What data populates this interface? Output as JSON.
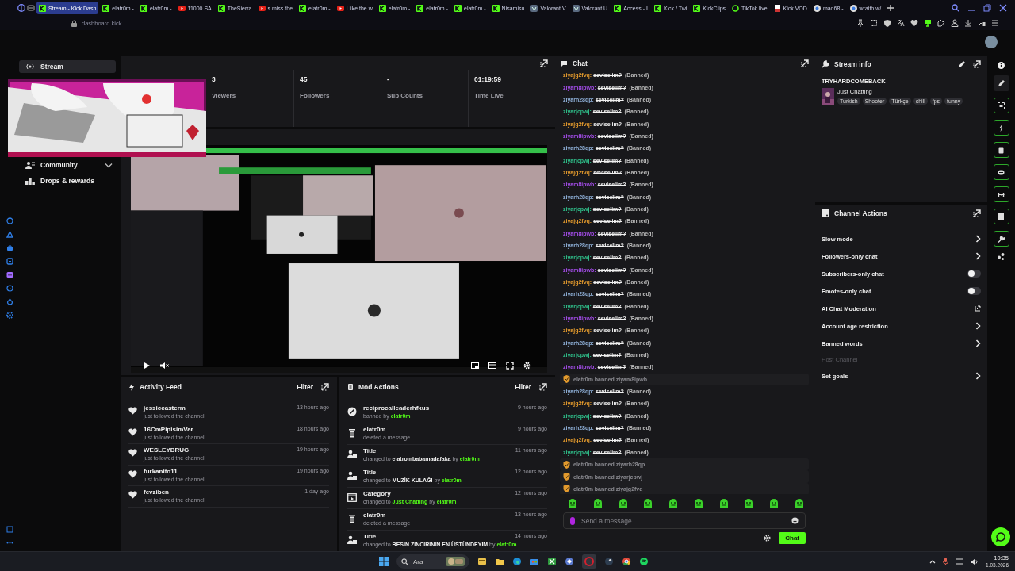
{
  "browser": {
    "tabs": [
      {
        "title": "Stream - Kick Dash",
        "kind": "kick",
        "selected": true
      },
      {
        "title": "elatr0m -",
        "kind": "kick",
        "selected": false
      },
      {
        "title": "elatr0m -",
        "kind": "kick",
        "selected": false
      },
      {
        "title": "11000 SA",
        "kind": "video",
        "selected": false
      },
      {
        "title": "TheSierra",
        "kind": "kick",
        "selected": false
      },
      {
        "title": "s miss the",
        "kind": "video",
        "selected": false
      },
      {
        "title": "elatr0m -",
        "kind": "kick",
        "selected": false
      },
      {
        "title": "I like the w",
        "kind": "video",
        "selected": false
      },
      {
        "title": "elatr0m -",
        "kind": "kick",
        "selected": false
      },
      {
        "title": "elatr0m -",
        "kind": "kick",
        "selected": false
      },
      {
        "title": "elatr0m -",
        "kind": "kick",
        "selected": false
      },
      {
        "title": "Nisamisu",
        "kind": "kick",
        "selected": false
      },
      {
        "title": "Valorant V",
        "kind": "game",
        "selected": false
      },
      {
        "title": "Valorant U",
        "kind": "game",
        "selected": false
      },
      {
        "title": "Access - I",
        "kind": "kick",
        "selected": false
      },
      {
        "title": "Kick / Twi",
        "kind": "kick",
        "selected": false
      },
      {
        "title": "KickClips",
        "kind": "kick",
        "selected": false
      },
      {
        "title": "TikTok live",
        "kind": "ring",
        "selected": false
      },
      {
        "title": "Kick VOD",
        "kind": "doc",
        "selected": false
      },
      {
        "title": "mad68 -",
        "kind": "globe",
        "selected": false
      },
      {
        "title": "wraith w/",
        "kind": "globe",
        "selected": false
      }
    ],
    "address": "dashboard.kick"
  },
  "sidebar": {
    "items": [
      {
        "label": "Stream",
        "kind": "stream",
        "selected": true,
        "expandable": false
      },
      {
        "label": "Community",
        "kind": "community",
        "selected": false,
        "expandable": true
      },
      {
        "label": "Drops & rewards",
        "kind": "drops",
        "selected": false,
        "expandable": false
      }
    ]
  },
  "stats": [
    {
      "value": "3",
      "label": "Viewers"
    },
    {
      "value": "45",
      "label": "Followers"
    },
    {
      "value": "-",
      "label": "Sub Counts"
    },
    {
      "value": "01:19:59",
      "label": "Time Live"
    }
  ],
  "activity_feed": {
    "title": "Activity Feed",
    "filter": "Filter",
    "items": [
      {
        "name": "jessiccasterm",
        "detail": "just followed the channel",
        "time": "13 hours ago"
      },
      {
        "name": "16CmPipisimVar",
        "detail": "just followed the channel",
        "time": "18 hours ago"
      },
      {
        "name": "WESLEYBRUG",
        "detail": "just followed the channel",
        "time": "19 hours ago"
      },
      {
        "name": "furkanito11",
        "detail": "just followed the channel",
        "time": "19 hours ago"
      },
      {
        "name": "fevziben",
        "detail": "just followed the channel",
        "time": "1 day ago"
      }
    ]
  },
  "mod_actions": {
    "title": "Mod Actions",
    "filter": "Filter",
    "items": [
      {
        "kind": "ban",
        "title": "reciprocalleaderhfkus",
        "time": "9 hours ago",
        "detail": [
          {
            "text": "banned by ",
            "kind": "plain"
          },
          {
            "text": "elatr0m",
            "kind": "link"
          }
        ]
      },
      {
        "kind": "delete",
        "title": "elatr0m",
        "time": "9 hours ago",
        "detail": [
          {
            "text": "deleted a message",
            "kind": "plain"
          }
        ]
      },
      {
        "kind": "title",
        "title": "Title",
        "time": "11 hours ago",
        "detail": [
          {
            "text": "changed to ",
            "kind": "plain"
          },
          {
            "text": "elatrombabamadafaka",
            "kind": "value"
          },
          {
            "text": " by ",
            "kind": "plain"
          },
          {
            "text": "elatr0m",
            "kind": "link"
          }
        ]
      },
      {
        "kind": "title",
        "title": "Title",
        "time": "12 hours ago",
        "detail": [
          {
            "text": "changed to ",
            "kind": "plain"
          },
          {
            "text": "MÜZİK KULAĞI",
            "kind": "value"
          },
          {
            "text": " by ",
            "kind": "plain"
          },
          {
            "text": "elatr0m",
            "kind": "link"
          }
        ]
      },
      {
        "kind": "category",
        "title": "Category",
        "time": "12 hours ago",
        "detail": [
          {
            "text": "changed to ",
            "kind": "plain"
          },
          {
            "text": "Just Chatting",
            "kind": "link"
          },
          {
            "text": " by ",
            "kind": "plain"
          },
          {
            "text": "elatr0m",
            "kind": "link"
          }
        ]
      },
      {
        "kind": "delete",
        "title": "elatr0m",
        "time": "13 hours ago",
        "detail": [
          {
            "text": "deleted a message",
            "kind": "plain"
          }
        ]
      },
      {
        "kind": "title",
        "title": "Title",
        "time": "14 hours ago",
        "detail": [
          {
            "text": "changed to ",
            "kind": "plain"
          },
          {
            "text": "BESİN ZİNCİRİNİN EN ÜSTÜNDEYİM",
            "kind": "value"
          },
          {
            "text": " by ",
            "kind": "plain"
          },
          {
            "text": "elatr0m",
            "kind": "link"
          }
        ]
      }
    ]
  },
  "chat": {
    "title": "Chat",
    "messages": [
      {
        "kind": "message",
        "user": "ziyajg2fvq:",
        "color": "#e39a2d",
        "text": "seviselim?",
        "note": "(Banned)",
        "deleted": true
      },
      {
        "kind": "message",
        "user": "ziyam8ipwb:",
        "color": "#a34de8",
        "text": "seviselim?",
        "note": "(Banned)",
        "deleted": true
      },
      {
        "kind": "message",
        "user": "ziyarh28qp:",
        "color": "#8fb0d8",
        "text": "seviselim?",
        "note": "(Banned)",
        "deleted": true
      },
      {
        "kind": "message",
        "user": "ziyarjcpwj:",
        "color": "#2fbf8a",
        "text": "seviselim?",
        "note": "(Banned)",
        "deleted": true
      },
      {
        "kind": "message",
        "user": "ziyajg2fvq:",
        "color": "#e39a2d",
        "text": "seviselim?",
        "note": "(Banned)",
        "deleted": true
      },
      {
        "kind": "message",
        "user": "ziyam8ipwb:",
        "color": "#a34de8",
        "text": "seviselim?",
        "note": "(Banned)",
        "deleted": true
      },
      {
        "kind": "message",
        "user": "ziyarh28qp:",
        "color": "#8fb0d8",
        "text": "seviselim?",
        "note": "(Banned)",
        "deleted": true
      },
      {
        "kind": "message",
        "user": "ziyarjcpwj:",
        "color": "#2fbf8a",
        "text": "seviselim?",
        "note": "(Banned)",
        "deleted": true
      },
      {
        "kind": "message",
        "user": "ziyajg2fvq:",
        "color": "#e39a2d",
        "text": "seviselim?",
        "note": "(Banned)",
        "deleted": true
      },
      {
        "kind": "message",
        "user": "ziyam8ipwb:",
        "color": "#a34de8",
        "text": "seviselim?",
        "note": "(Banned)",
        "deleted": true
      },
      {
        "kind": "message",
        "user": "ziyarh28qp:",
        "color": "#8fb0d8",
        "text": "seviselim?",
        "note": "(Banned)",
        "deleted": true
      },
      {
        "kind": "message",
        "user": "ziyarjcpwj:",
        "color": "#2fbf8a",
        "text": "seviselim?",
        "note": "(Banned)",
        "deleted": true
      },
      {
        "kind": "message",
        "user": "ziyajg2fvq:",
        "color": "#e39a2d",
        "text": "seviselim?",
        "note": "(Banned)",
        "deleted": true
      },
      {
        "kind": "message",
        "user": "ziyam8ipwb:",
        "color": "#a34de8",
        "text": "seviselim?",
        "note": "(Banned)",
        "deleted": true
      },
      {
        "kind": "message",
        "user": "ziyarh28qp:",
        "color": "#8fb0d8",
        "text": "seviselim?",
        "note": "(Banned)",
        "deleted": true
      },
      {
        "kind": "message",
        "user": "ziyarjcpwj:",
        "color": "#2fbf8a",
        "text": "seviselim?",
        "note": "(Banned)",
        "deleted": true
      },
      {
        "kind": "message",
        "user": "ziyam8ipwb:",
        "color": "#a34de8",
        "text": "seviselim?",
        "note": "(Banned)",
        "deleted": true
      },
      {
        "kind": "message",
        "user": "ziyajg2fvq:",
        "color": "#e39a2d",
        "text": "seviselim?",
        "note": "(Banned)",
        "deleted": true
      },
      {
        "kind": "message",
        "user": "ziyarh28qp:",
        "color": "#8fb0d8",
        "text": "seviselim?",
        "note": "(Banned)",
        "deleted": true
      },
      {
        "kind": "message",
        "user": "ziyarjcpwj:",
        "color": "#2fbf8a",
        "text": "seviselim?",
        "note": "(Banned)",
        "deleted": true
      },
      {
        "kind": "message",
        "user": "ziyam8ipwb:",
        "color": "#a34de8",
        "text": "seviselim?",
        "note": "(Banned)",
        "deleted": true
      },
      {
        "kind": "message",
        "user": "ziyajg2fvq:",
        "color": "#e39a2d",
        "text": "seviselim?",
        "note": "(Banned)",
        "deleted": true
      },
      {
        "kind": "message",
        "user": "ziyarh28qp:",
        "color": "#8fb0d8",
        "text": "seviselim?",
        "note": "(Banned)",
        "deleted": true
      },
      {
        "kind": "message",
        "user": "ziyarjcpwj:",
        "color": "#2fbf8a",
        "text": "seviselim?",
        "note": "(Banned)",
        "deleted": true
      },
      {
        "kind": "message",
        "user": "ziyam8ipwb:",
        "color": "#a34de8",
        "text": "seviselim?",
        "note": "(Banned)",
        "deleted": true
      },
      {
        "kind": "mod",
        "text": "elatr0m banned ziyam8ipwb"
      },
      {
        "kind": "message",
        "user": "ziyarh28qp:",
        "color": "#8fb0d8",
        "text": "seviselim?",
        "note": "(Banned)",
        "deleted": true
      },
      {
        "kind": "message",
        "user": "ziyajg2fvq:",
        "color": "#e39a2d",
        "text": "seviselim?",
        "note": "(Banned)",
        "deleted": true
      },
      {
        "kind": "message",
        "user": "ziyarjcpwj:",
        "color": "#2fbf8a",
        "text": "seviselim?",
        "note": "(Banned)",
        "deleted": true
      },
      {
        "kind": "message",
        "user": "ziyarh28qp:",
        "color": "#8fb0d8",
        "text": "seviselim?",
        "note": "(Banned)",
        "deleted": true
      },
      {
        "kind": "message",
        "user": "ziyajg2fvq:",
        "color": "#e39a2d",
        "text": "seviselim?",
        "note": "(Banned)",
        "deleted": true
      },
      {
        "kind": "message",
        "user": "ziyarjcpwj:",
        "color": "#2fbf8a",
        "text": "seviselim?",
        "note": "(Banned)",
        "deleted": true
      },
      {
        "kind": "mod",
        "text": "elatr0m banned ziyarh28qp"
      },
      {
        "kind": "mod",
        "text": "elatr0m banned ziyarjcpwj"
      },
      {
        "kind": "mod",
        "text": "elatr0m banned ziyajg2fvq"
      }
    ],
    "input": {
      "placeholder": "Send a message"
    },
    "send": "Chat"
  },
  "stream_info": {
    "title": "Stream info",
    "channel": "TRYHARDCOMEBACK",
    "category": "Just Chatting",
    "tags": [
      "Turkish",
      "Shooter",
      "Türkçe",
      "chill",
      "fps",
      "funny"
    ]
  },
  "channel_actions": {
    "title": "Channel Actions",
    "items": [
      {
        "label": "Slow mode",
        "kind": "chevron",
        "disabled": false
      },
      {
        "label": "Followers-only chat",
        "kind": "chevron",
        "disabled": false
      },
      {
        "label": "Subscribers-only chat",
        "kind": "toggle",
        "on": false,
        "disabled": false
      },
      {
        "label": "Emotes-only chat",
        "kind": "toggle",
        "on": false,
        "disabled": false
      },
      {
        "label": "AI Chat Moderation",
        "kind": "external",
        "disabled": false
      },
      {
        "label": "Account age restriction",
        "kind": "chevron",
        "disabled": false
      },
      {
        "label": "Banned words",
        "kind": "chevron",
        "disabled": false
      },
      {
        "label": "Host Channel",
        "kind": "plain",
        "disabled": true
      },
      {
        "label": "Set goals",
        "kind": "chevron",
        "disabled": false
      }
    ]
  },
  "taskbar": {
    "search": "Ara",
    "time": "10:35",
    "date": "1.03.2026"
  }
}
